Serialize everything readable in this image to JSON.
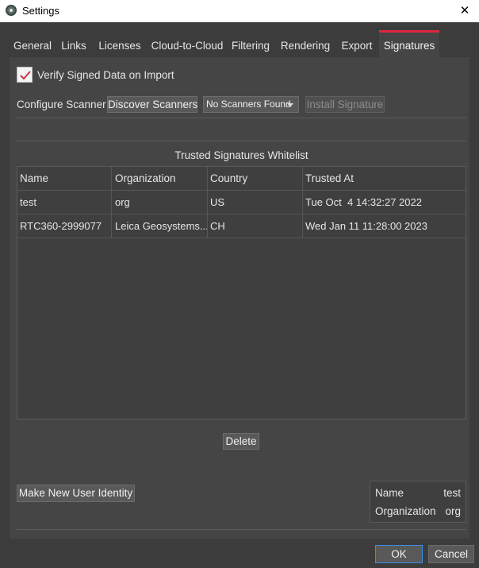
{
  "window": {
    "title": "Settings",
    "app_icon": "app-logo-icon",
    "close_icon": "close-icon"
  },
  "tabs": [
    {
      "label": "General"
    },
    {
      "label": "Links"
    },
    {
      "label": "Licenses"
    },
    {
      "label": "Cloud-to-Cloud"
    },
    {
      "label": "Filtering"
    },
    {
      "label": "Rendering"
    },
    {
      "label": "Export"
    },
    {
      "label": "Signatures",
      "active": true
    }
  ],
  "signatures": {
    "verify_checkbox": {
      "label": "Verify Signed Data on Import",
      "checked": true
    },
    "configure_scanner_label": "Configure Scanner",
    "discover_button": "Discover Scanners",
    "scanner_select": {
      "value": "No Scanners Found"
    },
    "install_button": "Install Signature",
    "whitelist_title": "Trusted Signatures Whitelist",
    "table": {
      "columns": [
        "Name",
        "Organization",
        "Country",
        "Trusted At"
      ],
      "rows": [
        [
          "test",
          "org",
          "US",
          "Tue Oct  4 14:32:27 2022"
        ],
        [
          "RTC360-2999077",
          "Leica Geosystems...",
          "CH",
          "Wed Jan 11 11:28:00 2023"
        ]
      ]
    },
    "delete_button": "Delete",
    "new_identity_button": "Make New User Identity",
    "identity": {
      "name_label": "Name",
      "name_value": "test",
      "org_label": "Organization",
      "org_value": "org"
    }
  },
  "footer": {
    "ok_label": "OK",
    "cancel_label": "Cancel"
  },
  "colors": {
    "accent": "#e0263d",
    "background": "#3c3c3c",
    "panel": "#454545",
    "focus": "#3a8ee6"
  }
}
